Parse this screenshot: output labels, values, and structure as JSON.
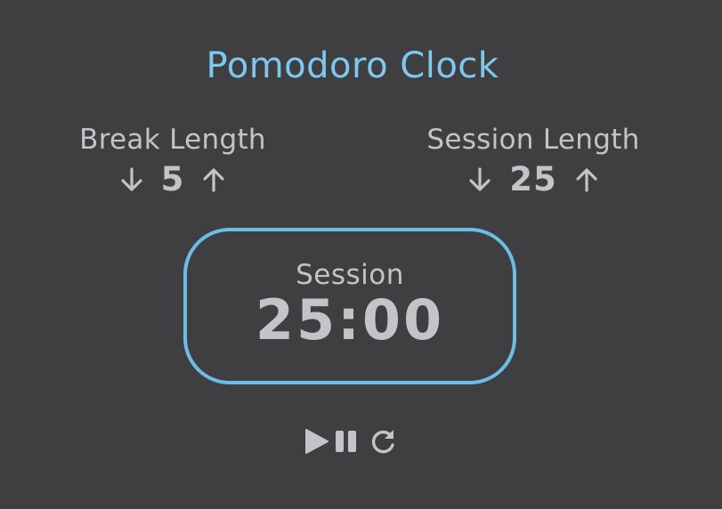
{
  "title": "Pomodoro Clock",
  "break": {
    "label": "Break Length",
    "value": "5",
    "decrement_icon": "arrow-down-icon",
    "increment_icon": "arrow-up-icon"
  },
  "session": {
    "label": "Session Length",
    "value": "25",
    "decrement_icon": "arrow-down-icon",
    "increment_icon": "arrow-up-icon"
  },
  "timer": {
    "label": "Session",
    "time_left": "25:00"
  },
  "controls": {
    "play_icon": "play-icon",
    "pause_icon": "pause-icon",
    "reset_icon": "refresh-icon"
  },
  "colors": {
    "background": "#3f3f42",
    "accent": "#7ec8f0",
    "border": "#6dbce8",
    "text": "#c4c4c8"
  }
}
